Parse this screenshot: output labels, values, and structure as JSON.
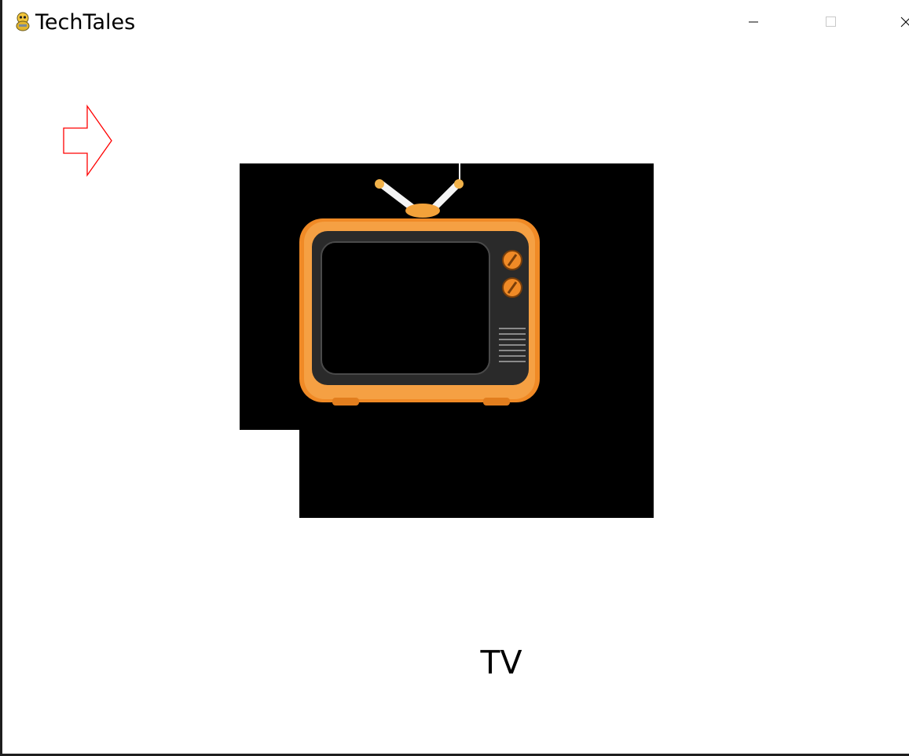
{
  "window": {
    "title": "TechTales",
    "controls": {
      "minimize_icon": "minimize-icon",
      "maximize_icon": "maximize-icon",
      "close_icon": "close-icon"
    }
  },
  "scene": {
    "arrow_icon": "right-arrow-icon",
    "arrow_color": "#ff0000",
    "image_icon": "television-image",
    "label": "TV"
  },
  "colors": {
    "tv_body": "#f08a26",
    "tv_screen": "#000000",
    "image_background": "#000000"
  }
}
